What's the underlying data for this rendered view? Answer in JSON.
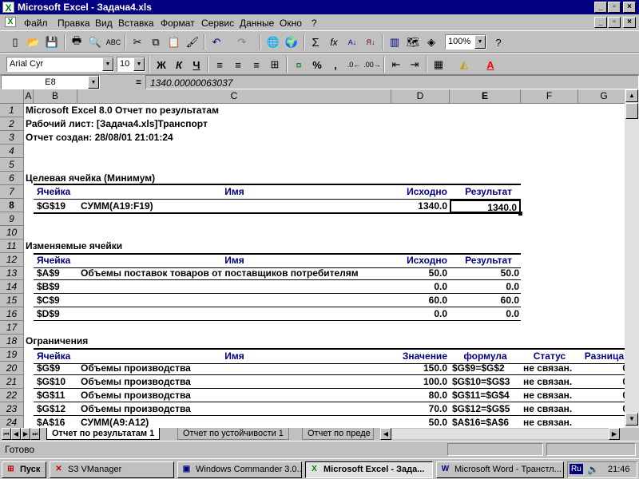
{
  "window": {
    "title": "Microsoft Excel - Задача4.xls",
    "app_icon": "excel-icon"
  },
  "menu": [
    "Файл",
    "Правка",
    "Вид",
    "Вставка",
    "Формат",
    "Сервис",
    "Данные",
    "Окно",
    "?"
  ],
  "toolbar": {
    "zoom": "100%",
    "font": "Arial Cyr",
    "size": "10",
    "bold": "Ж",
    "italic": "К",
    "underline": "Ч",
    "sigma": "Σ",
    "fx": "fx",
    "percent": "%",
    "comma": ","
  },
  "formula_bar": {
    "name_box": "E8",
    "equals": "=",
    "value": "1340.00000063037"
  },
  "columns": [
    "A",
    "B",
    "C",
    "D",
    "E",
    "F",
    "G"
  ],
  "rows": [
    "1",
    "2",
    "3",
    "4",
    "5",
    "6",
    "7",
    "8",
    "9",
    "10",
    "11",
    "12",
    "13",
    "14",
    "15",
    "16",
    "17",
    "18",
    "19",
    "20",
    "21",
    "22",
    "23",
    "24"
  ],
  "report": {
    "line1": "Microsoft Excel 8.0 Отчет по результатам",
    "line2": "Рабочий лист: [Задача4.xls]Транспорт",
    "line3": "Отчет создан: 28/08/01 21:01:24",
    "target": {
      "section": "Целевая ячейка (Минимум)",
      "headers": {
        "cell": "Ячейка",
        "name": "Имя",
        "orig": "Исходно",
        "result": "Результат"
      },
      "row": {
        "cell": "$G$19",
        "name": "СУММ(A19:F19)",
        "orig": "1340.0",
        "result": "1340.0"
      }
    },
    "changing": {
      "section": "Изменяемые ячейки",
      "headers": {
        "cell": "Ячейка",
        "name": "Имя",
        "orig": "Исходно",
        "result": "Результат"
      },
      "rows": [
        {
          "cell": "$A$9",
          "name": "Объемы поставок товаров от поставщиков потребителям",
          "orig": "50.0",
          "result": "50.0"
        },
        {
          "cell": "$B$9",
          "name": "",
          "orig": "0.0",
          "result": "0.0"
        },
        {
          "cell": "$C$9",
          "name": "",
          "orig": "60.0",
          "result": "60.0"
        },
        {
          "cell": "$D$9",
          "name": "",
          "orig": "0.0",
          "result": "0.0"
        }
      ]
    },
    "constraints": {
      "section": "Ограничения",
      "headers": {
        "cell": "Ячейка",
        "name": "Имя",
        "value": "Значение",
        "formula": "формула",
        "status": "Статус",
        "diff": "Разница"
      },
      "rows": [
        {
          "cell": "$G$9",
          "name": "Объемы производства",
          "value": "150.0",
          "formula": "$G$9=$G$2",
          "status": "не связан.",
          "diff": "0"
        },
        {
          "cell": "$G$10",
          "name": "Объемы производства",
          "value": "100.0",
          "formula": "$G$10=$G$3",
          "status": "не связан.",
          "diff": "0"
        },
        {
          "cell": "$G$11",
          "name": "Объемы производства",
          "value": "80.0",
          "formula": "$G$11=$G$4",
          "status": "не связан.",
          "diff": "0"
        },
        {
          "cell": "$G$12",
          "name": "Объемы производства",
          "value": "70.0",
          "formula": "$G$12=$G$5",
          "status": "не связан.",
          "diff": "0"
        },
        {
          "cell": "$A$16",
          "name": "СУММ(A9:A12)",
          "value": "50.0",
          "formula": "$A$16=$A$6",
          "status": "не связан.",
          "diff": ""
        }
      ]
    }
  },
  "sheet_tabs": [
    "Отчет по результатам 1",
    "Отчет по устойчивости 1",
    "Отчет по преде"
  ],
  "status": {
    "text": "Готово"
  },
  "taskbar": {
    "start": "Пуск",
    "tasks": [
      "S3 VManager",
      "Windows Commander 3.0...",
      "Microsoft Excel - Зада...",
      "Microsoft Word - Транстл..."
    ],
    "lang": "Ru",
    "clock": "21:46"
  }
}
